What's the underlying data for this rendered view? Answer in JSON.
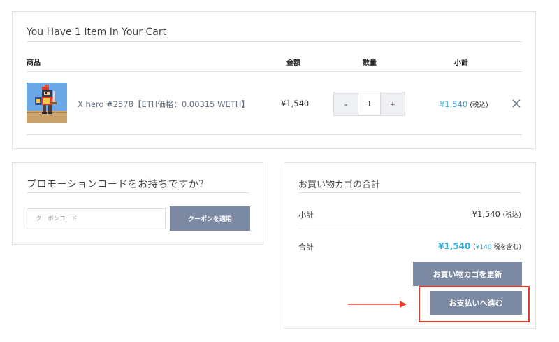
{
  "cart": {
    "title": "You Have 1 Item In Your Cart",
    "columns": {
      "product": "商品",
      "price": "金額",
      "quantity": "数量",
      "subtotal": "小計"
    },
    "items": [
      {
        "thumbnail_icon": "pixel-hero-icon",
        "name": "X hero #2578【ETH価格：0.00315 WETH】",
        "price": "¥1,540",
        "quantity": "1",
        "qty_minus": "-",
        "qty_plus": "+",
        "subtotal": "¥1,540",
        "subtotal_tax_note": "(税込)",
        "remove_icon": "close-icon"
      }
    ]
  },
  "promo": {
    "title": "プロモーションコードをお持ちですか？",
    "input_placeholder": "クーポンコード",
    "apply_label": "クーポンを適用"
  },
  "totals": {
    "title": "お買い物カゴの合計",
    "subtotal_label": "小計",
    "subtotal_value": "¥1,540",
    "subtotal_tax_note": "(税込)",
    "total_label": "合計",
    "total_value": "¥1,540",
    "total_tax_open": "(",
    "total_tax_amount": "¥140",
    "total_tax_note": " 税を含む)",
    "update_label": "お買い物カゴを更新",
    "checkout_label": "お支払いへ進む"
  },
  "annotation": {
    "arrow_icon": "right-arrow-icon",
    "highlight_color": "#e53b2a"
  },
  "colors": {
    "accent": "#2fa8d9",
    "button": "#7b8aa2",
    "border": "#e2e2e2"
  }
}
